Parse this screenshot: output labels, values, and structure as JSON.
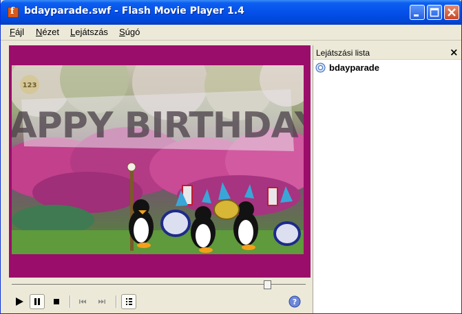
{
  "window": {
    "title": "bdayparade.swf - Flash Movie Player 1.4"
  },
  "menu": {
    "items": [
      {
        "label": "Fájl"
      },
      {
        "label": "Nézet"
      },
      {
        "label": "Lejátszás"
      },
      {
        "label": "Súgó"
      }
    ]
  },
  "movie": {
    "banner_text": "HAPPY BIRTHDAY!",
    "logo_text": "123",
    "colors": {
      "frame": "#9b0d6a",
      "grass": "#5f9a3c",
      "flowers": "#c2408c"
    }
  },
  "player": {
    "seek_position": 0.88,
    "icons": [
      "play-icon",
      "pause-icon",
      "stop-icon",
      "previous-icon",
      "next-icon",
      "playlist-icon",
      "help-icon"
    ]
  },
  "playlist": {
    "title": "Lejátszási lista",
    "close_symbol": "×",
    "items": [
      {
        "label": "bdayparade"
      }
    ]
  }
}
